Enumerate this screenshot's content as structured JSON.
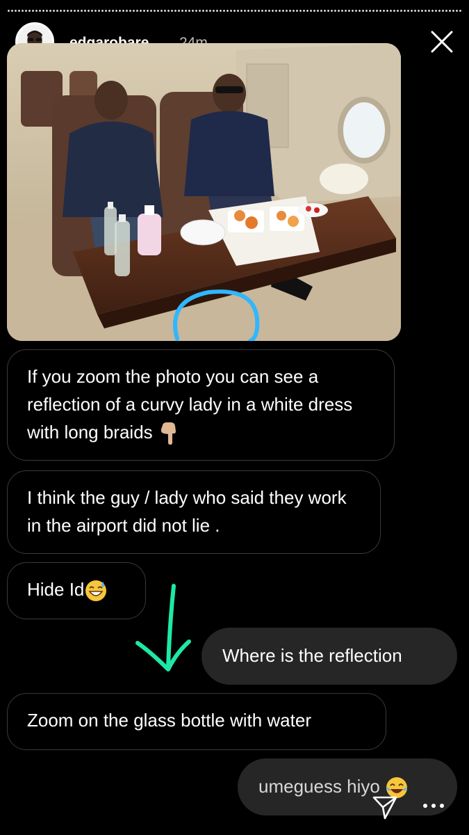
{
  "story": {
    "username": "edgarobare",
    "time_ago": "24m"
  },
  "photo": {
    "alt": "Two men seated in a private jet cabin with food on a wooden table, a glass bottle circled in blue"
  },
  "messages": [
    {
      "type": "received",
      "text": "If you zoom the photo you can see a reflection of a curvy lady in a white dress with long braids",
      "emoji": "pointing-down-hand"
    },
    {
      "type": "received",
      "text": "I think the guy / lady who said they work in the airport did not lie .",
      "emoji": ""
    },
    {
      "type": "received",
      "text": "Hide Id",
      "emoji": "grinning-sweat-face"
    },
    {
      "type": "sent",
      "text": "Where is the reflection",
      "emoji": ""
    },
    {
      "type": "received",
      "text": "Zoom on the glass bottle with water",
      "emoji": ""
    },
    {
      "type": "sent",
      "text": "umeguess hiyo",
      "emoji": "tears-of-joy-face"
    }
  ],
  "colors": {
    "background": "#000000",
    "sent_bubble": "#262626",
    "received_border": "#3a3a3a",
    "annotation_arrow": "#1de9a6",
    "annotation_circle": "#2fb7ff"
  },
  "icons": {
    "close": "close-icon",
    "send": "send-icon",
    "more": "more-options-icon"
  }
}
